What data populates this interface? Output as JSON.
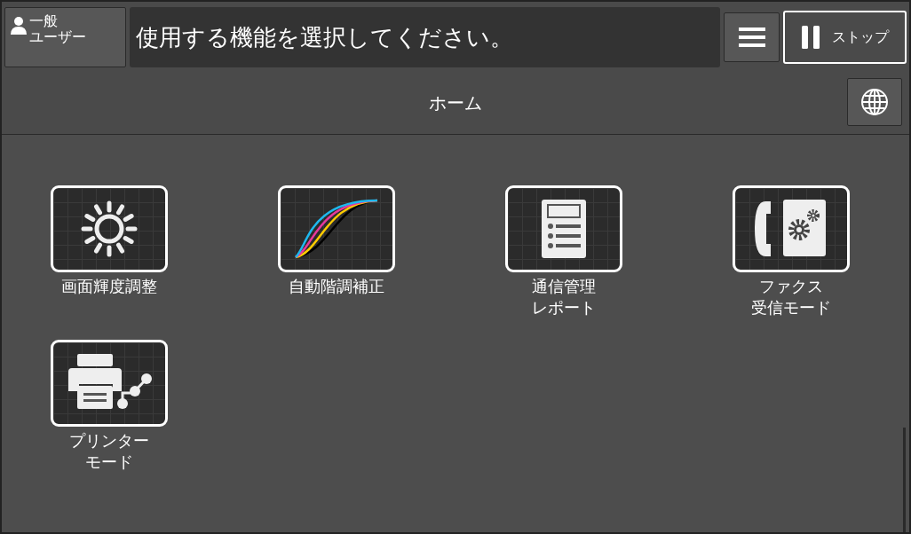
{
  "user_button": {
    "lines": [
      "一般",
      "ユーザー"
    ]
  },
  "message": "使用する機能を選択してください。",
  "stop_button": {
    "label": "ストップ"
  },
  "header": {
    "title": "ホーム"
  },
  "apps": [
    {
      "kind": "brightness",
      "label_lines": [
        "画面輝度調整"
      ]
    },
    {
      "kind": "tone-curve",
      "label_lines": [
        "自動階調補正"
      ]
    },
    {
      "kind": "report",
      "label_lines": [
        "通信管理",
        "レポート"
      ]
    },
    {
      "kind": "fax",
      "label_lines": [
        "ファクス",
        "受信モード"
      ]
    },
    {
      "kind": "printer",
      "label_lines": [
        "プリンター",
        "モード"
      ]
    }
  ]
}
